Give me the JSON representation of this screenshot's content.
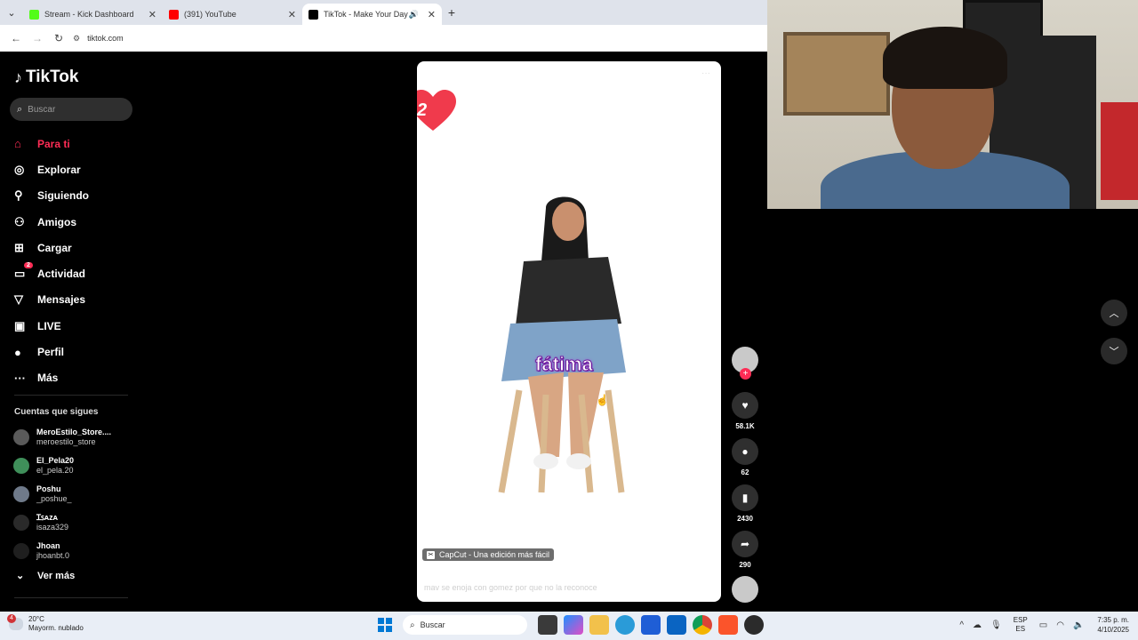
{
  "browser": {
    "tabs": [
      {
        "title": "Stream - Kick Dashboard",
        "favicon_color": "#53fc18",
        "active": false
      },
      {
        "title": "(391) YouTube",
        "favicon_color": "#ff0000",
        "active": false
      },
      {
        "title": "TikTok - Make Your Day",
        "favicon_color": "#000000",
        "active": true
      }
    ],
    "url": "tiktok.com"
  },
  "sidebar": {
    "logo": "TikTok",
    "search_placeholder": "Buscar",
    "nav": [
      {
        "label": "Para ti",
        "icon": "home-icon",
        "active": true
      },
      {
        "label": "Explorar",
        "icon": "compass-icon"
      },
      {
        "label": "Siguiendo",
        "icon": "following-icon"
      },
      {
        "label": "Amigos",
        "icon": "friends-icon"
      },
      {
        "label": "Cargar",
        "icon": "upload-icon"
      },
      {
        "label": "Actividad",
        "icon": "activity-icon",
        "badge": "2"
      },
      {
        "label": "Mensajes",
        "icon": "messages-icon"
      },
      {
        "label": "LIVE",
        "icon": "live-icon"
      },
      {
        "label": "Perfil",
        "icon": "profile-icon"
      },
      {
        "label": "Más",
        "icon": "more-icon"
      }
    ],
    "following_header": "Cuentas que sigues",
    "following": [
      {
        "name": "MeroEstilo_Store....",
        "handle": "meroestilo_store",
        "avatar_color": "#5a5a5a"
      },
      {
        "name": "El_Pela20",
        "handle": "el_pela.20",
        "avatar_color": "#3f8f5a"
      },
      {
        "name": "Poshu",
        "handle": "_poshue_",
        "avatar_color": "#6f7a8a"
      },
      {
        "name": "Ɪꜱᴀᴢᴀ",
        "handle": "isaza329",
        "avatar_color": "#2a2a2a"
      },
      {
        "name": "Jhoan",
        "handle": "jhoanbt.0",
        "avatar_color": "#1f1f1f"
      }
    ],
    "see_more": "Ver más"
  },
  "video": {
    "sticker_number": "2",
    "overlay_name": "fátima",
    "capcut_label": "CapCut - Una edición más fácil",
    "description": "mav se enoja con gomez por que no la reconoce"
  },
  "actions": {
    "likes": "58.1K",
    "comments": "62",
    "saves": "2430",
    "shares": "290"
  },
  "taskbar": {
    "temperature": "20°C",
    "weather": "Mayorm. nublado",
    "weather_badge": "4",
    "search_placeholder": "Buscar",
    "lang_line1": "ESP",
    "lang_line2": "ES",
    "time": "7:35 p. m.",
    "date": "4/10/2025"
  }
}
